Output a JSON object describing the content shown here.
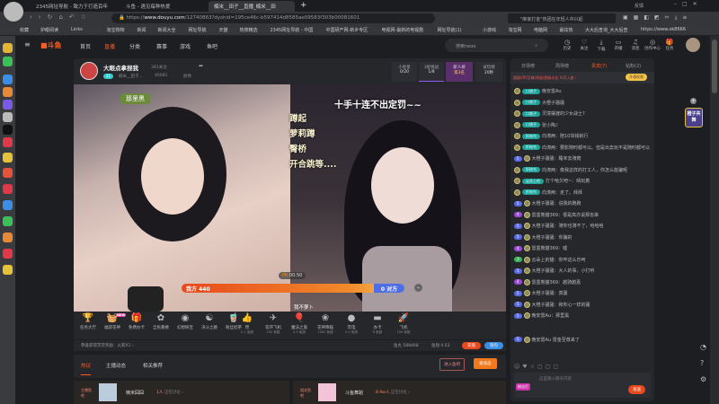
{
  "browser": {
    "tabs": [
      "2345网址导航 - 致力于打造百年",
      "斗鱼 - 遇见每种热爱",
      "楠米__田子__直播_楠米__田"
    ],
    "url_host": "www.douyu.com",
    "url_prefix": "https://",
    "url_rest": "/12740863?dyshid=195ce46c-b597414d8585ae09583f303b00081601",
    "search_placeholder": "\"麻家打金\"热团在年轻人中兴起",
    "window_label": "反馈",
    "bookmarks": [
      "收藏",
      "护眼阅读",
      "Links",
      "淘宝购物",
      "新闻",
      "新闻大全",
      "网址导航",
      "天猫",
      "热搜精选",
      "2345网址导航 - 中国",
      "中国研产网-新乡专区",
      "电视网-最新的电视剧",
      "网址导航(1)",
      "小游戏",
      "淘宝网",
      "电脑网",
      "最炫热",
      "大大后查询_大大后查",
      "https://www.ok8666"
    ]
  },
  "header": {
    "nav": [
      "首页",
      "直播",
      "分类",
      "赛事",
      "游戏",
      "鱼吧"
    ],
    "search_placeholder": "搜索rwoo",
    "icons": [
      "历史",
      "关注",
      "下载",
      "开播",
      "消息",
      "创作中心",
      "任务"
    ],
    "brand_color": "#ff5d23"
  },
  "room": {
    "streamer": "大眼点拿捏我",
    "follow_count": "381关注",
    "level": "21",
    "room_name": "楠米__田子...",
    "hot": "40081",
    "category": "颜秀",
    "stats": [
      {
        "label": "小星星",
        "value": "0/20"
      },
      {
        "label": "3星挑战",
        "value": "1/8"
      },
      {
        "label": "新人榜",
        "value": "第3名"
      },
      {
        "label": "试玩榜",
        "value": "20秒"
      }
    ]
  },
  "video": {
    "left_sign": "那里黑",
    "right_title": "十手十连不出定罚~~",
    "left_lines": [
      "蹲起",
      "萝莉蹲",
      "臀桥",
      "开合跳等...."
    ],
    "pk_label": "PK",
    "pk_time": "00:50",
    "our_side": "我方 440",
    "their_side": "0 对方",
    "opponent": "我不萝卜",
    "pk_progress": 1.0
  },
  "gifts": {
    "left": [
      {
        "name": "任务大厅"
      },
      {
        "name": "福袋花神",
        "badge": "NEW"
      },
      {
        "name": "免费办卡"
      },
      {
        "name": "全民暴换"
      },
      {
        "name": "幻想探宝"
      },
      {
        "name": "决斗之路"
      },
      {
        "name": "粉丝奶茶"
      }
    ],
    "right": [
      {
        "name": "赞",
        "price": "0.1 鱼翅"
      },
      {
        "name": "花环飞机",
        "price": "100 鱼翅"
      },
      {
        "name": "魔法之旅",
        "price": "0.5 鱼翅"
      },
      {
        "name": "花神降临",
        "price": "2000 鱼翅"
      },
      {
        "name": "荧电",
        "price": "0.2 鱼翅"
      },
      {
        "name": "办卡",
        "price": "6 鱼翅"
      },
      {
        "name": "飞机",
        "price": "100 鱼翅"
      }
    ],
    "reward_text": "恭喜获得荧荧奖励：火箭X1 ›",
    "fish_balls": "鱼丸 588468",
    "fish_fins": "鱼翅 0.63",
    "recharge": "充值",
    "backpack": "背包"
  },
  "bottom": {
    "tabs": [
      "热议",
      "主播动态",
      "相关推荐"
    ],
    "enter_bar": "进入鱼吧",
    "post": "发动态",
    "cards": [
      {
        "tag": "主播鱼吧",
        "name": "楠米囧囧",
        "count": "1人",
        "suffix": "正在讨论 ›"
      },
      {
        "tag": "相关鱼吧",
        "name": "斗鱼舞蹈",
        "count": "8.9w人",
        "suffix": "正在讨论 ›"
      }
    ]
  },
  "chat": {
    "tabs": [
      "日场榜",
      "周场榜",
      "贵宾(7)",
      "钻粉(2)"
    ],
    "notice": "超级VIP/至尊/贵族/超级水友 均可入座 ›",
    "vip_button": "开通权限",
    "messages": [
      {
        "fan": "口袋子",
        "text": "晚安雷Au"
      },
      {
        "fan": "口袋子",
        "text": "大橙子骚骚"
      },
      {
        "fan": "口袋子",
        "text": "灵境摆渡的少女战士?"
      },
      {
        "fan": "口袋子",
        "text": "张小陶♪"
      },
      {
        "fan": "折枝鸟",
        "text": "向涛两：陪10块钱就行"
      },
      {
        "fan": "折枝鸟",
        "text": "向涛两：要影随时都可以。但是出去玩不是随时都可以"
      },
      {
        "lv": "5",
        "text": "大橙子骚骚：睡末去骑爬"
      },
      {
        "fan": "折枝鸟",
        "text": "向涛两：像我这样的打工人，你怎么能骗呢"
      },
      {
        "fan": "云朵上的",
        "text": "打个哈欠吧~：晴玩着"
      },
      {
        "fan": "折枝鸟",
        "text": "向涛两：走了。拜拜"
      },
      {
        "lv": "5",
        "text": "大橙子骚骚：说我的跑跑"
      },
      {
        "lv": "4",
        "text": "雷墨熊猫369：很是高亦说那省串"
      },
      {
        "lv": "5",
        "text": "大橙子骚骚：骑你也骑不了，哈哈哈"
      },
      {
        "lv": "5",
        "text": "大橙子骚骚：你骗的"
      },
      {
        "lv": "4",
        "text": "雷墨熊猫369：嘘"
      },
      {
        "lv": "3",
        "text": "云朵上的猫：你咋这么乐呵"
      },
      {
        "lv": "5",
        "text": "大橙子骚骚：大人的事，小打听"
      },
      {
        "lv": "4",
        "text": "雷墨熊猫369：越骑越嘉"
      },
      {
        "lv": "5",
        "text": "大橙子骚骚：真骚"
      },
      {
        "lv": "5",
        "text": "大橙子骚骚：和你心一样的骚"
      },
      {
        "lv": "5",
        "text": "晚安雷Au：那里黑"
      },
      {
        "lv": "5",
        "text": "晚安雷Au 雷金至尊来了"
      }
    ],
    "input_placeholder": "这里输入聊天内容",
    "send": "发送",
    "user_badge": "粉丝灯"
  },
  "float": {
    "label": "橙子共舞"
  }
}
